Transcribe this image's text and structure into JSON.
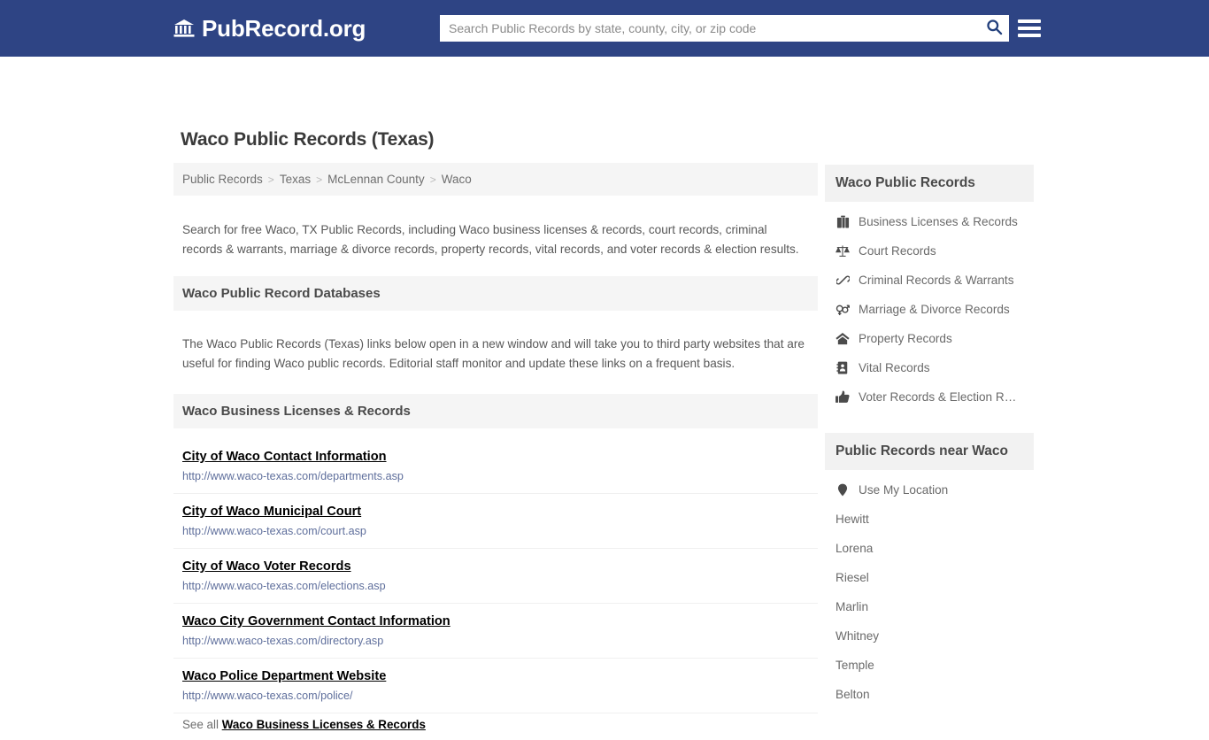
{
  "header": {
    "brand_name": "PubRecord.org",
    "brand_icon": "bank-icon",
    "search_placeholder": "Search Public Records by state, county, city, or zip code",
    "search_value": "",
    "search_icon": "search-icon",
    "menu_icon": "hamburger-menu-icon",
    "background_color": "#2e4484"
  },
  "main": {
    "page_title": "Waco Public Records (Texas)",
    "breadcrumb": [
      {
        "label": "Public Records"
      },
      {
        "label": "Texas"
      },
      {
        "label": "McLennan County"
      },
      {
        "label": "Waco"
      }
    ],
    "breadcrumb_separator": ">",
    "intro": "Search for free Waco, TX Public Records, including Waco business licenses & records, court records, criminal records & warrants, marriage & divorce records, property records, vital records, and voter records & election results.",
    "databases_heading": "Waco Public Record Databases",
    "databases_body": "The Waco Public Records (Texas) links below open in a new window and will take you to third party websites that are useful for finding Waco public records. Editorial staff monitor and update these links on a frequent basis.",
    "business_heading": "Waco Business Licenses & Records",
    "links": [
      {
        "title": "City of Waco Contact Information",
        "url": "http://www.waco-texas.com/departments.asp"
      },
      {
        "title": "City of Waco Municipal Court",
        "url": "http://www.waco-texas.com/court.asp"
      },
      {
        "title": "City of Waco Voter Records",
        "url": "http://www.waco-texas.com/elections.asp"
      },
      {
        "title": "Waco City Government Contact Information",
        "url": "http://www.waco-texas.com/directory.asp"
      },
      {
        "title": "Waco Police Department Website",
        "url": "http://www.waco-texas.com/police/"
      }
    ],
    "see_all_prefix": "See all",
    "see_all_link": "Waco Business Licenses & Records"
  },
  "sidebar": {
    "records_heading": "Waco Public Records",
    "records_items": [
      {
        "label": "Business Licenses & Records",
        "icon": "briefcase-icon"
      },
      {
        "label": "Court Records",
        "icon": "balance-scale-icon"
      },
      {
        "label": "Criminal Records & Warrants",
        "icon": "handcuffs-icon"
      },
      {
        "label": "Marriage & Divorce Records",
        "icon": "venus-mars-icon"
      },
      {
        "label": "Property Records",
        "icon": "home-icon"
      },
      {
        "label": "Vital Records",
        "icon": "address-card-icon"
      },
      {
        "label": "Voter Records & Election R…",
        "icon": "thumbs-up-icon"
      }
    ],
    "near_heading": "Public Records near Waco",
    "use_my_location": {
      "label": "Use My Location",
      "icon": "map-pin-icon"
    },
    "near_items": [
      {
        "label": "Hewitt"
      },
      {
        "label": "Lorena"
      },
      {
        "label": "Riesel"
      },
      {
        "label": "Marlin"
      },
      {
        "label": "Whitney"
      },
      {
        "label": "Temple"
      },
      {
        "label": "Belton"
      }
    ]
  }
}
